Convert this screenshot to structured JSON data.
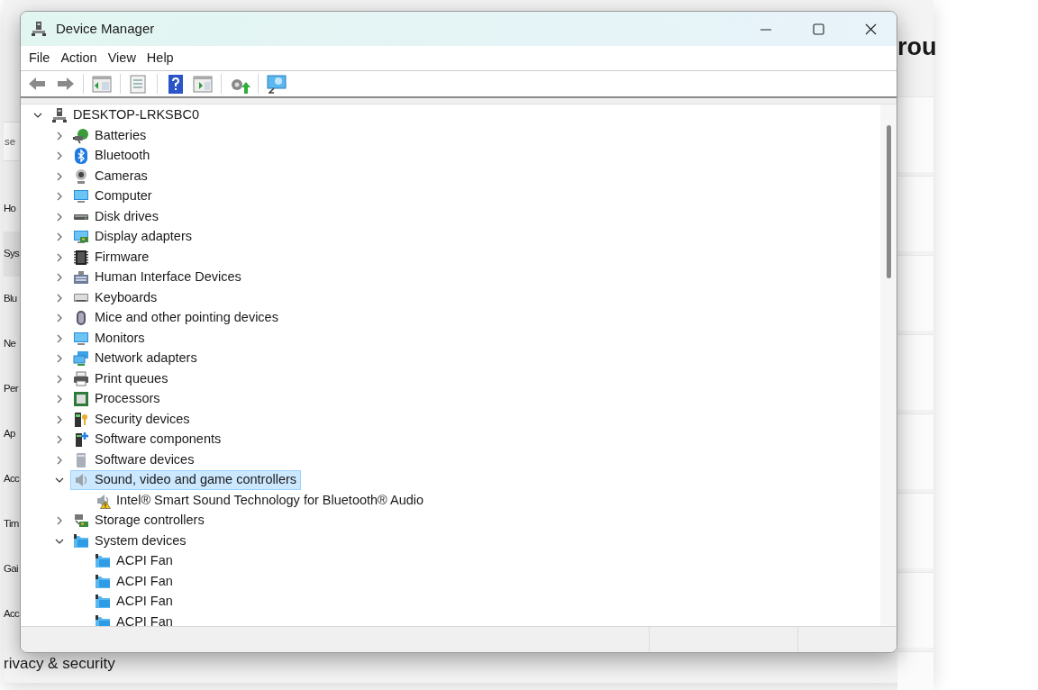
{
  "background_window": {
    "search": {
      "placeholder": "se"
    },
    "nav": [
      {
        "label": "Ho",
        "selected": false
      },
      {
        "label": "Sys",
        "selected": true
      },
      {
        "label": "Blu",
        "selected": false
      },
      {
        "label": "Ne",
        "selected": false
      },
      {
        "label": "Per",
        "selected": false
      },
      {
        "label": "Ap",
        "selected": false
      },
      {
        "label": "Acc",
        "selected": false
      },
      {
        "label": "Tim",
        "selected": false
      },
      {
        "label": "Gai",
        "selected": false
      },
      {
        "label": "Acc",
        "selected": false
      },
      {
        "label": "rivacy & security",
        "selected": false
      }
    ],
    "heading": "rou"
  },
  "window": {
    "title": "Device Manager"
  },
  "menu": [
    "File",
    "Action",
    "View",
    "Help"
  ],
  "tree": [
    {
      "label": "DESKTOP-LRKSBC0",
      "kind": "root",
      "expanded": true,
      "selected": false,
      "children": [
        {
          "label": "Batteries",
          "kind": "battery",
          "expanded": false,
          "selected": false
        },
        {
          "label": "Bluetooth",
          "kind": "bluetooth",
          "expanded": false,
          "selected": false
        },
        {
          "label": "Cameras",
          "kind": "camera",
          "expanded": false,
          "selected": false
        },
        {
          "label": "Computer",
          "kind": "monitor",
          "expanded": false,
          "selected": false
        },
        {
          "label": "Disk drives",
          "kind": "disk",
          "expanded": false,
          "selected": false
        },
        {
          "label": "Display adapters",
          "kind": "display",
          "expanded": false,
          "selected": false
        },
        {
          "label": "Firmware",
          "kind": "chip",
          "expanded": false,
          "selected": false
        },
        {
          "label": "Human Interface Devices",
          "kind": "hid",
          "expanded": false,
          "selected": false
        },
        {
          "label": "Keyboards",
          "kind": "keyboard",
          "expanded": false,
          "selected": false
        },
        {
          "label": "Mice and other pointing devices",
          "kind": "mouse",
          "expanded": false,
          "selected": false
        },
        {
          "label": "Monitors",
          "kind": "monitor",
          "expanded": false,
          "selected": false
        },
        {
          "label": "Network adapters",
          "kind": "network",
          "expanded": false,
          "selected": false
        },
        {
          "label": "Print queues",
          "kind": "printer",
          "expanded": false,
          "selected": false
        },
        {
          "label": "Processors",
          "kind": "processor",
          "expanded": false,
          "selected": false
        },
        {
          "label": "Security devices",
          "kind": "security",
          "expanded": false,
          "selected": false
        },
        {
          "label": "Software components",
          "kind": "swcomp",
          "expanded": false,
          "selected": false
        },
        {
          "label": "Software devices",
          "kind": "swdev",
          "expanded": false,
          "selected": false
        },
        {
          "label": "Sound, video and game controllers",
          "kind": "sound",
          "expanded": true,
          "selected": true,
          "children": [
            {
              "label": "Intel® Smart Sound Technology for Bluetooth® Audio",
              "kind": "sound",
              "warning": true,
              "selected": false
            }
          ]
        },
        {
          "label": "Storage controllers",
          "kind": "storage",
          "expanded": false,
          "selected": false
        },
        {
          "label": "System devices",
          "kind": "system",
          "expanded": true,
          "selected": false,
          "children": [
            {
              "label": "ACPI Fan",
              "kind": "system",
              "selected": false
            },
            {
              "label": "ACPI Fan",
              "kind": "system",
              "selected": false
            },
            {
              "label": "ACPI Fan",
              "kind": "system",
              "selected": false
            },
            {
              "label": "ACPI Fan",
              "kind": "system",
              "selected": false
            }
          ]
        }
      ]
    }
  ]
}
